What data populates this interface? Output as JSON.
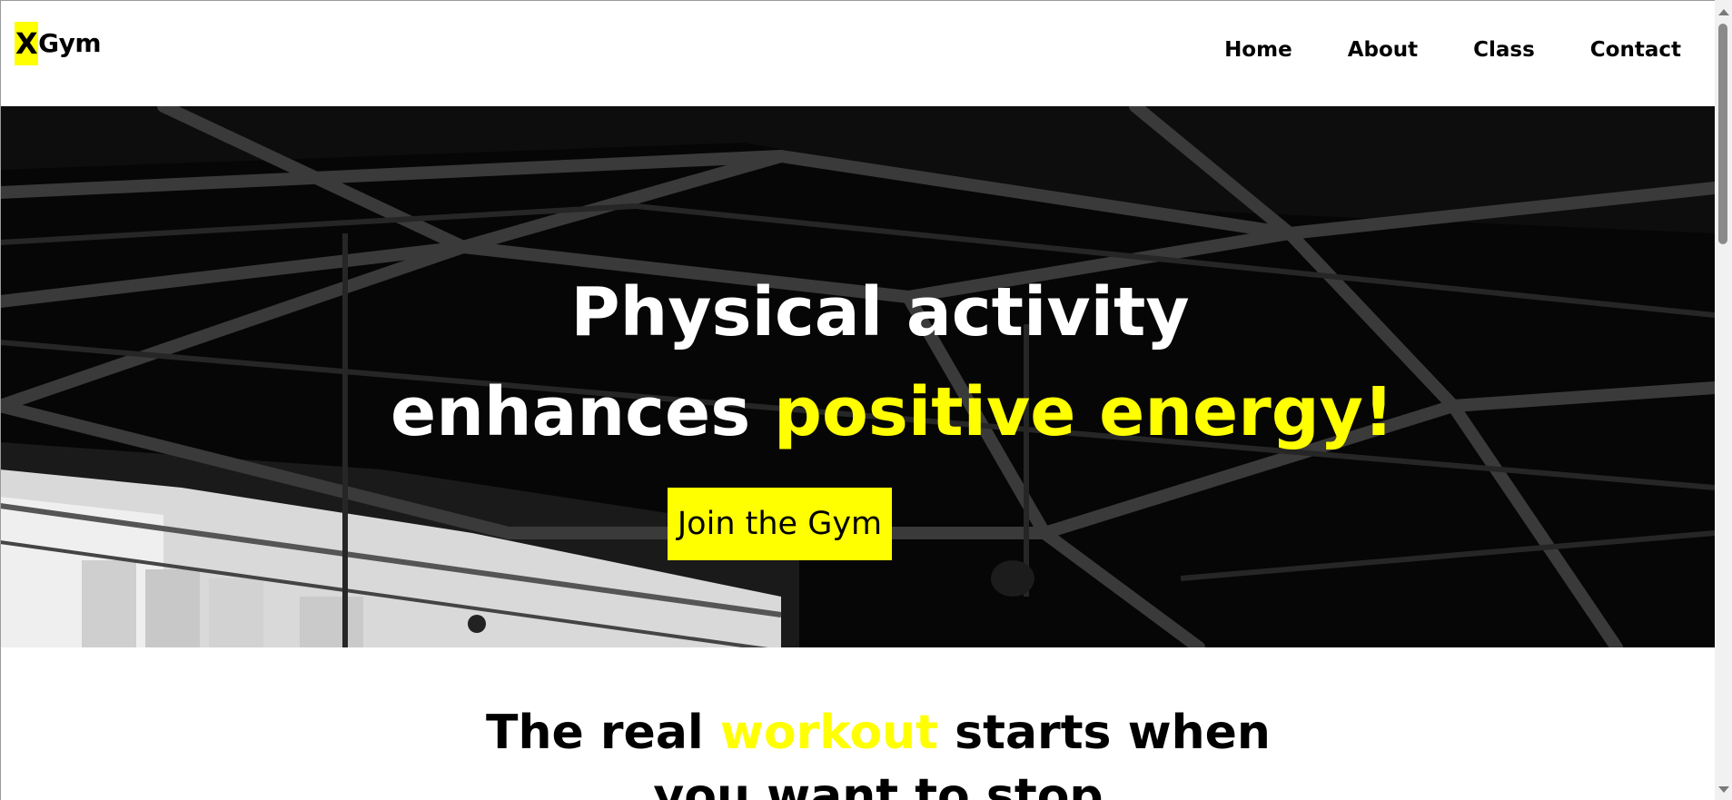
{
  "brand": {
    "logo_x": "X",
    "logo_rest": "Gym",
    "accent_color": "#ffff00"
  },
  "nav": {
    "items": [
      {
        "label": "Home"
      },
      {
        "label": "About"
      },
      {
        "label": "Class"
      },
      {
        "label": "Contact"
      }
    ]
  },
  "hero": {
    "line1": "Physical activity",
    "line2_plain": "enhances ",
    "line2_highlight": "positive energy!",
    "cta_label": "Join the Gym",
    "background_icon": "gym-ceiling-photo"
  },
  "section": {
    "title_part1": "The real ",
    "title_highlight": "workout",
    "title_part2": " starts when you want to stop"
  },
  "scrollbar": {
    "up_icon": "scroll-up-arrow-icon",
    "down_icon": "scroll-down-arrow-icon"
  }
}
